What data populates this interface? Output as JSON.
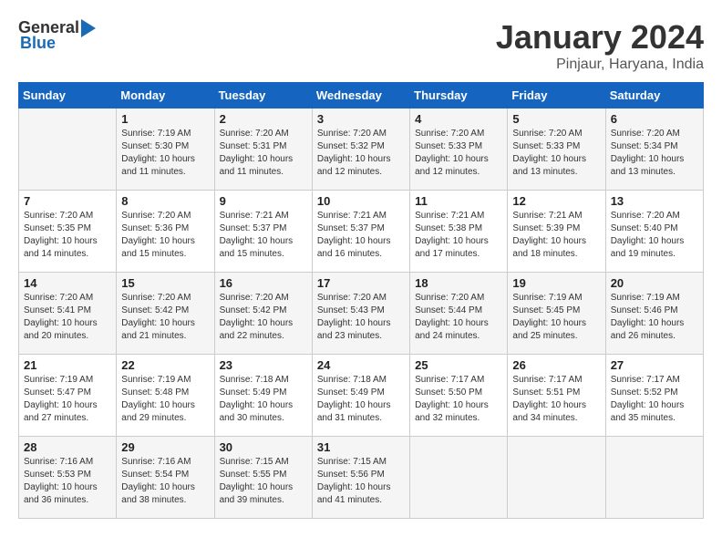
{
  "header": {
    "logo_general": "General",
    "logo_blue": "Blue",
    "month_title": "January 2024",
    "location": "Pinjaur, Haryana, India"
  },
  "days_of_week": [
    "Sunday",
    "Monday",
    "Tuesday",
    "Wednesday",
    "Thursday",
    "Friday",
    "Saturday"
  ],
  "weeks": [
    [
      {
        "day": "",
        "info": ""
      },
      {
        "day": "1",
        "info": "Sunrise: 7:19 AM\nSunset: 5:30 PM\nDaylight: 10 hours\nand 11 minutes."
      },
      {
        "day": "2",
        "info": "Sunrise: 7:20 AM\nSunset: 5:31 PM\nDaylight: 10 hours\nand 11 minutes."
      },
      {
        "day": "3",
        "info": "Sunrise: 7:20 AM\nSunset: 5:32 PM\nDaylight: 10 hours\nand 12 minutes."
      },
      {
        "day": "4",
        "info": "Sunrise: 7:20 AM\nSunset: 5:33 PM\nDaylight: 10 hours\nand 12 minutes."
      },
      {
        "day": "5",
        "info": "Sunrise: 7:20 AM\nSunset: 5:33 PM\nDaylight: 10 hours\nand 13 minutes."
      },
      {
        "day": "6",
        "info": "Sunrise: 7:20 AM\nSunset: 5:34 PM\nDaylight: 10 hours\nand 13 minutes."
      }
    ],
    [
      {
        "day": "7",
        "info": "Sunrise: 7:20 AM\nSunset: 5:35 PM\nDaylight: 10 hours\nand 14 minutes."
      },
      {
        "day": "8",
        "info": "Sunrise: 7:20 AM\nSunset: 5:36 PM\nDaylight: 10 hours\nand 15 minutes."
      },
      {
        "day": "9",
        "info": "Sunrise: 7:21 AM\nSunset: 5:37 PM\nDaylight: 10 hours\nand 15 minutes."
      },
      {
        "day": "10",
        "info": "Sunrise: 7:21 AM\nSunset: 5:37 PM\nDaylight: 10 hours\nand 16 minutes."
      },
      {
        "day": "11",
        "info": "Sunrise: 7:21 AM\nSunset: 5:38 PM\nDaylight: 10 hours\nand 17 minutes."
      },
      {
        "day": "12",
        "info": "Sunrise: 7:21 AM\nSunset: 5:39 PM\nDaylight: 10 hours\nand 18 minutes."
      },
      {
        "day": "13",
        "info": "Sunrise: 7:20 AM\nSunset: 5:40 PM\nDaylight: 10 hours\nand 19 minutes."
      }
    ],
    [
      {
        "day": "14",
        "info": "Sunrise: 7:20 AM\nSunset: 5:41 PM\nDaylight: 10 hours\nand 20 minutes."
      },
      {
        "day": "15",
        "info": "Sunrise: 7:20 AM\nSunset: 5:42 PM\nDaylight: 10 hours\nand 21 minutes."
      },
      {
        "day": "16",
        "info": "Sunrise: 7:20 AM\nSunset: 5:42 PM\nDaylight: 10 hours\nand 22 minutes."
      },
      {
        "day": "17",
        "info": "Sunrise: 7:20 AM\nSunset: 5:43 PM\nDaylight: 10 hours\nand 23 minutes."
      },
      {
        "day": "18",
        "info": "Sunrise: 7:20 AM\nSunset: 5:44 PM\nDaylight: 10 hours\nand 24 minutes."
      },
      {
        "day": "19",
        "info": "Sunrise: 7:19 AM\nSunset: 5:45 PM\nDaylight: 10 hours\nand 25 minutes."
      },
      {
        "day": "20",
        "info": "Sunrise: 7:19 AM\nSunset: 5:46 PM\nDaylight: 10 hours\nand 26 minutes."
      }
    ],
    [
      {
        "day": "21",
        "info": "Sunrise: 7:19 AM\nSunset: 5:47 PM\nDaylight: 10 hours\nand 27 minutes."
      },
      {
        "day": "22",
        "info": "Sunrise: 7:19 AM\nSunset: 5:48 PM\nDaylight: 10 hours\nand 29 minutes."
      },
      {
        "day": "23",
        "info": "Sunrise: 7:18 AM\nSunset: 5:49 PM\nDaylight: 10 hours\nand 30 minutes."
      },
      {
        "day": "24",
        "info": "Sunrise: 7:18 AM\nSunset: 5:49 PM\nDaylight: 10 hours\nand 31 minutes."
      },
      {
        "day": "25",
        "info": "Sunrise: 7:17 AM\nSunset: 5:50 PM\nDaylight: 10 hours\nand 32 minutes."
      },
      {
        "day": "26",
        "info": "Sunrise: 7:17 AM\nSunset: 5:51 PM\nDaylight: 10 hours\nand 34 minutes."
      },
      {
        "day": "27",
        "info": "Sunrise: 7:17 AM\nSunset: 5:52 PM\nDaylight: 10 hours\nand 35 minutes."
      }
    ],
    [
      {
        "day": "28",
        "info": "Sunrise: 7:16 AM\nSunset: 5:53 PM\nDaylight: 10 hours\nand 36 minutes."
      },
      {
        "day": "29",
        "info": "Sunrise: 7:16 AM\nSunset: 5:54 PM\nDaylight: 10 hours\nand 38 minutes."
      },
      {
        "day": "30",
        "info": "Sunrise: 7:15 AM\nSunset: 5:55 PM\nDaylight: 10 hours\nand 39 minutes."
      },
      {
        "day": "31",
        "info": "Sunrise: 7:15 AM\nSunset: 5:56 PM\nDaylight: 10 hours\nand 41 minutes."
      },
      {
        "day": "",
        "info": ""
      },
      {
        "day": "",
        "info": ""
      },
      {
        "day": "",
        "info": ""
      }
    ]
  ]
}
